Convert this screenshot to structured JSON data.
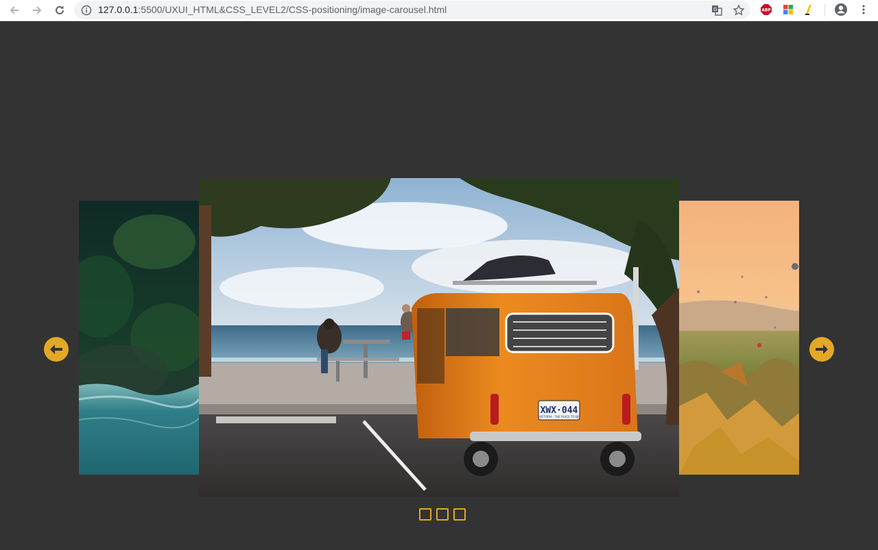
{
  "browser": {
    "url_host": "127.0.0.1",
    "url_path": ":5500/UXUI_HTML&CSS_LEVEL2/CSS-positioning/image-carousel.html",
    "extensions": {
      "abp_label": "ABP"
    }
  },
  "carousel": {
    "accent": "#e3a826",
    "background": "#333333",
    "slides": [
      {
        "name": "waterfall-forest-photo",
        "position": "left"
      },
      {
        "name": "orange-van-beach-photo",
        "position": "center",
        "plate": "XWX·044",
        "plate_sub": "VICTORIA - THE PLACE TO BE"
      },
      {
        "name": "hot-air-balloon-valley-photo",
        "position": "right"
      }
    ],
    "prev_icon": "arrow-left-icon",
    "next_icon": "arrow-right-icon",
    "indicators": 3
  }
}
